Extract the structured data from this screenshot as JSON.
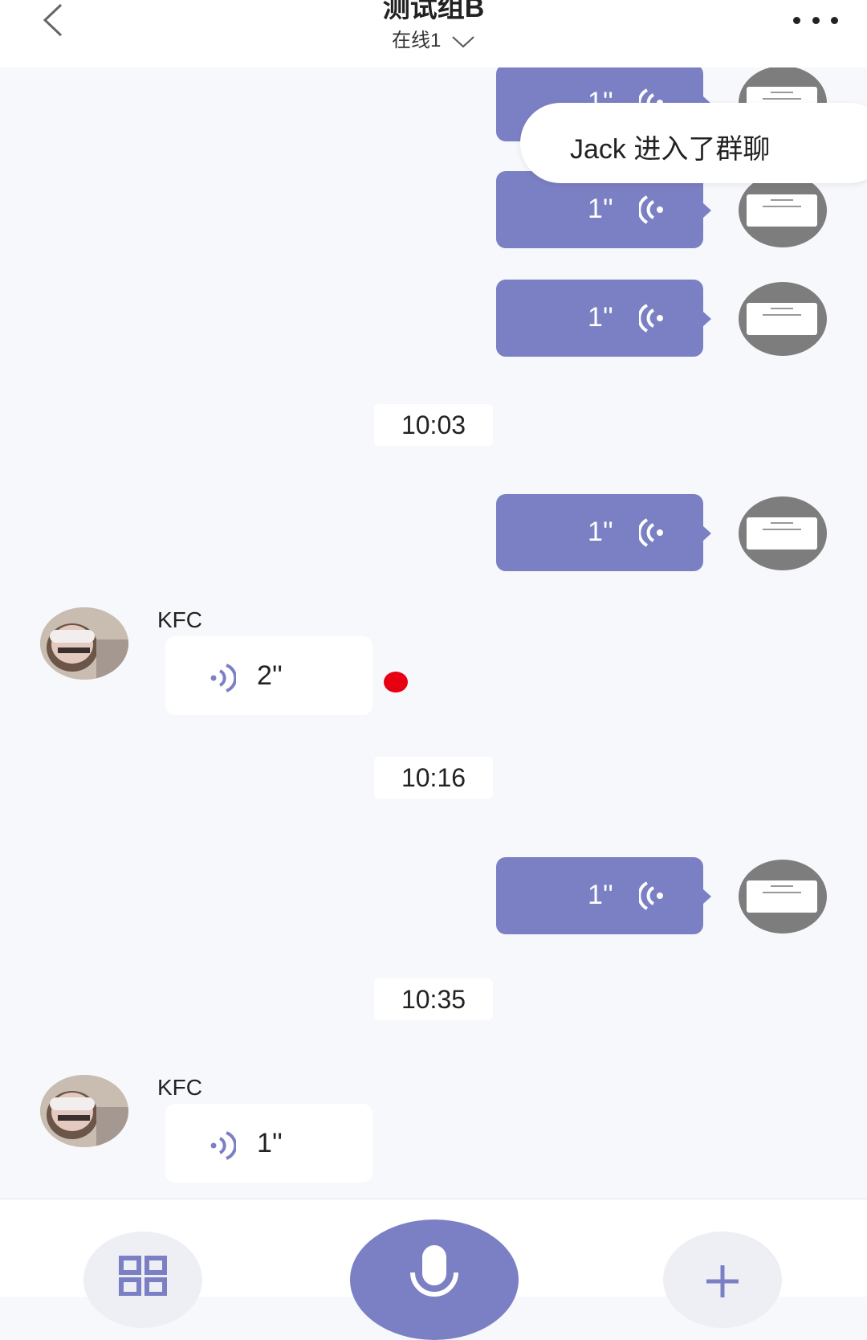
{
  "header": {
    "title": "测试组B",
    "online_status": "在线1"
  },
  "toast": {
    "text": "Jack 进入了群聊"
  },
  "messages": {
    "out1": {
      "duration": "1''"
    },
    "out2": {
      "duration": "1''"
    },
    "out3": {
      "duration": "1''"
    },
    "time1": "10:03",
    "out4": {
      "duration": "1''"
    },
    "in1": {
      "sender": "KFC",
      "duration": "2''"
    },
    "time2": "10:16",
    "out5": {
      "duration": "1''"
    },
    "time3": "10:35",
    "in2": {
      "sender": "KFC",
      "duration": "1''"
    }
  },
  "colors": {
    "accent": "#7b80c4",
    "unread_dot": "#e60012",
    "background": "#f7f8fb"
  },
  "icons": {
    "back": "chevron-left-icon",
    "more": "more-dots-icon",
    "dropdown": "chevron-down-icon",
    "voice": "voice-wave-icon",
    "grid": "grid-icon",
    "mic": "microphone-icon",
    "plus": "plus-icon"
  }
}
